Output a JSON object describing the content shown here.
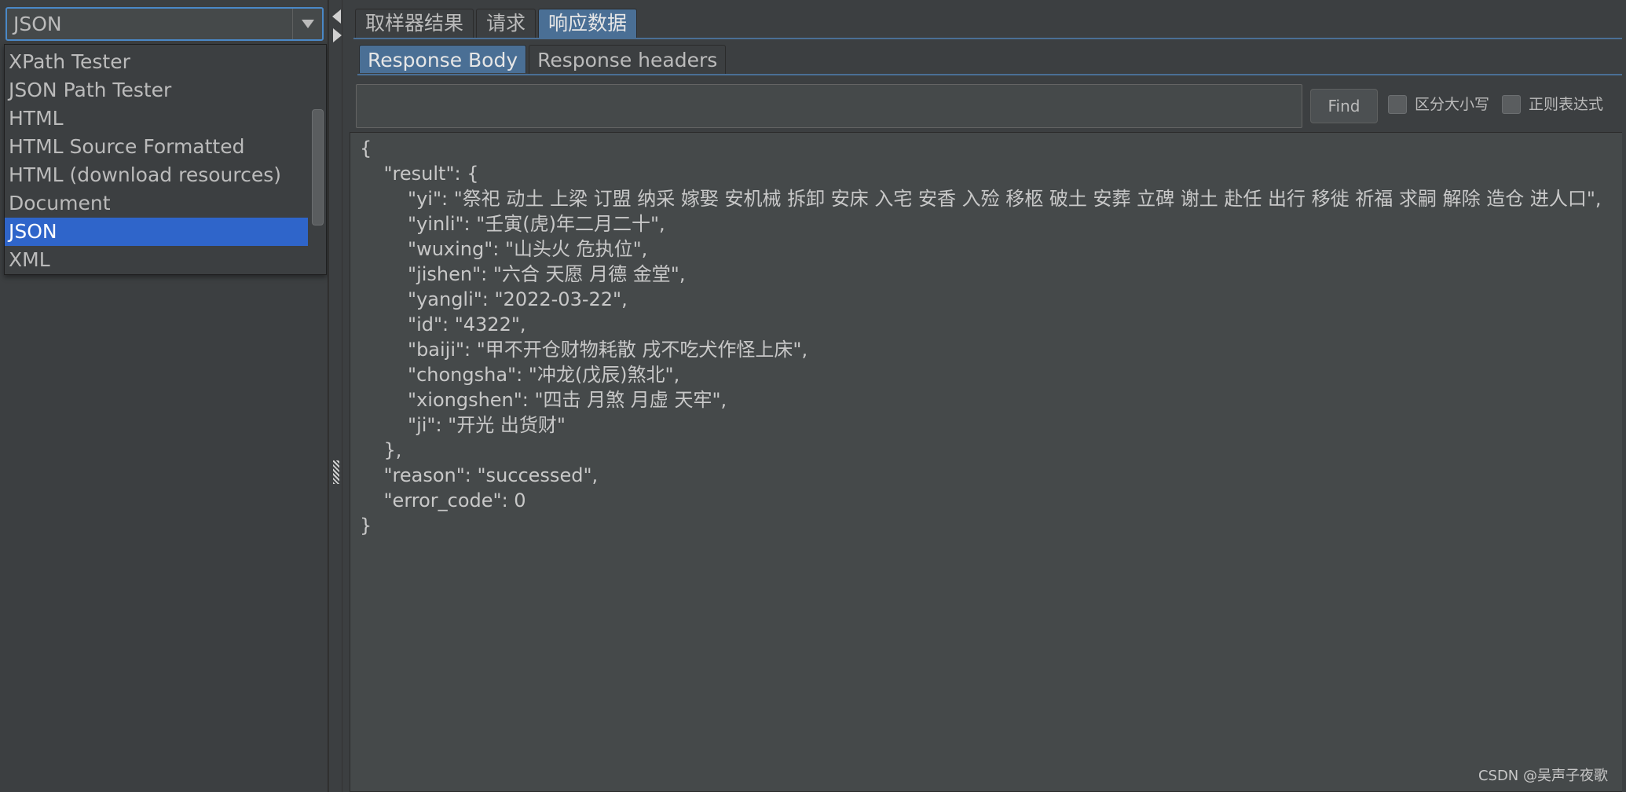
{
  "left_panel": {
    "combo_value": "JSON",
    "renderers": [
      {
        "label": "XPath Tester",
        "selected": false
      },
      {
        "label": "JSON Path Tester",
        "selected": false
      },
      {
        "label": "HTML",
        "selected": false
      },
      {
        "label": "HTML Source Formatted",
        "selected": false
      },
      {
        "label": "HTML (download resources)",
        "selected": false
      },
      {
        "label": "Document",
        "selected": false
      },
      {
        "label": "JSON",
        "selected": true
      },
      {
        "label": "XML",
        "selected": false
      }
    ]
  },
  "tabs": {
    "main": [
      "取样器结果",
      "请求",
      "响应数据"
    ],
    "main_active": 2,
    "sub": [
      "Response Body",
      "Response headers"
    ],
    "sub_active": 0
  },
  "search": {
    "value": "",
    "find_label": "Find",
    "case_sensitive_label": "区分大小写",
    "regex_label": "正则表达式"
  },
  "response_body": "{\n    \"result\": {\n        \"yi\": \"祭祀 动土 上梁 订盟 纳采 嫁娶 安机械 拆卸 安床 入宅 安香 入殓 移柩 破土 安葬 立碑 谢土 赴任 出行 移徙 祈福 求嗣 解除 造仓 进人口\",\n        \"yinli\": \"壬寅(虎)年二月二十\",\n        \"wuxing\": \"山头火 危执位\",\n        \"jishen\": \"六合 天愿 月德 金堂\",\n        \"yangli\": \"2022-03-22\",\n        \"id\": \"4322\",\n        \"baiji\": \"甲不开仓财物耗散 戌不吃犬作怪上床\",\n        \"chongsha\": \"冲龙(戊辰)煞北\",\n        \"xiongshen\": \"四击 月煞 月虚 天牢\",\n        \"ji\": \"开光 出货财\"\n    },\n    \"reason\": \"successed\",\n    \"error_code\": 0\n}",
  "watermark": "CSDN @吴声子夜歌",
  "colors": {
    "background": "#3c3f41",
    "selection": "#2f65ca",
    "active_tab": "#4a6f95",
    "text": "#bbbbbb"
  }
}
